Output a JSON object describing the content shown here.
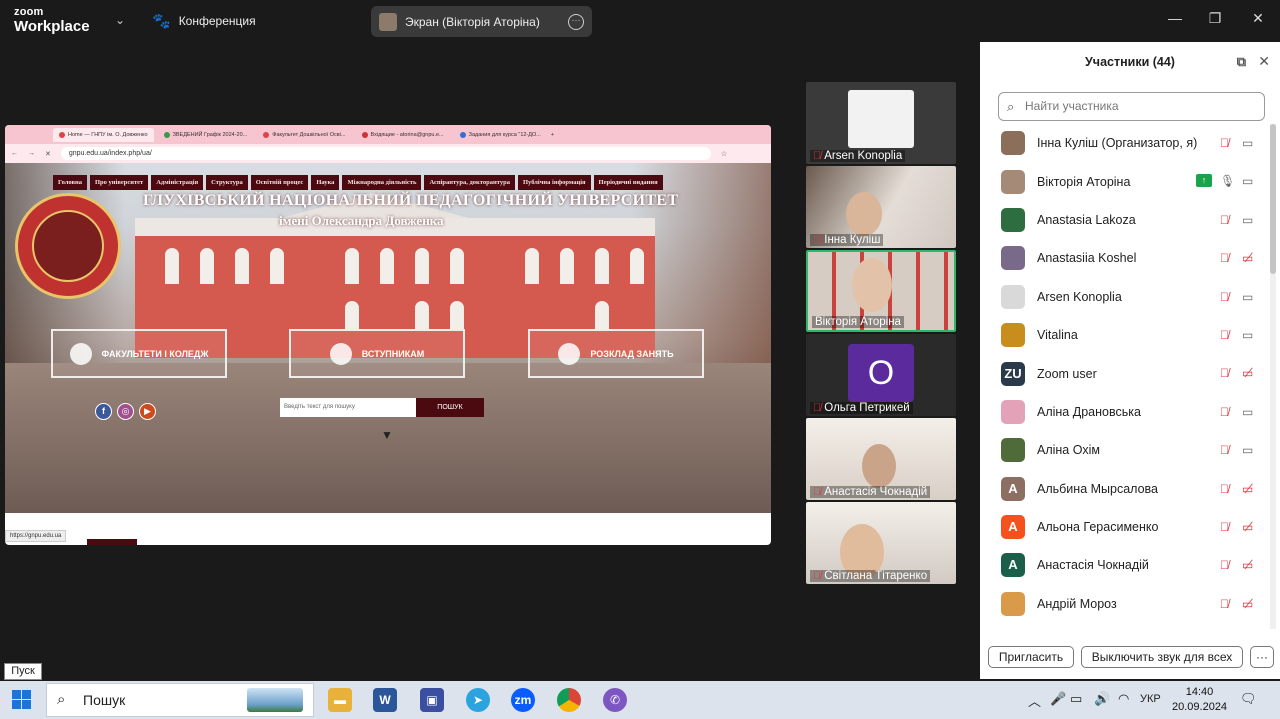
{
  "zoom": {
    "logo_top": "zoom",
    "logo_bottom": "Workplace",
    "meeting_label": "Конференция",
    "share_label": "Экран (Вікторія Аторіна)",
    "win_min": "—",
    "win_restore": "❐",
    "win_close": "✕"
  },
  "browser": {
    "tabs": [
      "Home — ГНПУ ім. О. Довженко",
      "ЗВЕДЕНИЙ Графік 2024-20...",
      "Факультет Дошкільної Осві...",
      "Вхідящие - atorina@gnpu.e...",
      "Задания для курса \"12-ДО..."
    ],
    "url": "gnpu.edu.ua/index.php/ua/",
    "status_url": "https://gnpu.edu.ua"
  },
  "site": {
    "nav": [
      "Головна",
      "Про університет",
      "Адміністрація",
      "Структура",
      "Освітній процес",
      "Наука",
      "Міжнародна діяльність",
      "Аспірантура, докторантура",
      "Публічна інформація",
      "Періодичні видання"
    ],
    "title": "ГЛУХІВСЬКИЙ НАЦІОНАЛЬНИЙ ПЕДАГОГІЧНИЙ УНІВЕРСИТЕТ",
    "subtitle": "імені Олександра Довженка",
    "cta": [
      "ФАКУЛЬТЕТИ І КОЛЕДЖ",
      "ВСТУПНИКАМ",
      "РОЗКЛАД ЗАНЯТЬ"
    ],
    "search_placeholder": "Введіть текст для пошуку",
    "search_button": "ПОШУК"
  },
  "tiles": [
    "Arsen Konoplia",
    "Інна Куліш",
    "Вікторія Аторіна",
    "Ольга Петрикей",
    "Анастасія Чокнадій",
    "Світлана Тітаренко"
  ],
  "tile_avatar_letter": "O",
  "panel": {
    "title": "Участники (44)",
    "search_placeholder": "Найти участника",
    "invite": "Пригласить",
    "mute_all": "Выключить звук для всех",
    "more": "···",
    "participants": [
      {
        "name": "Інна Куліш (Организатор, я)",
        "avatar": "",
        "color": "#8b6f5a"
      },
      {
        "name": "Вікторія Аторіна",
        "avatar": "",
        "color": "#a58a78"
      },
      {
        "name": "Anastasia Lakoza",
        "avatar": "",
        "color": "#2d6d3f"
      },
      {
        "name": "Anastasiia Koshel",
        "avatar": "",
        "color": "#7a6a8a"
      },
      {
        "name": "Arsen Konoplia",
        "avatar": "",
        "color": "#d9d9d9"
      },
      {
        "name": "Vitalina",
        "avatar": "",
        "color": "#c98d1e"
      },
      {
        "name": "Zoom user",
        "avatar": "ZU",
        "color": "#2b3a4a"
      },
      {
        "name": "Аліна Драновська",
        "avatar": "",
        "color": "#e3a2b8"
      },
      {
        "name": "Аліна Охім",
        "avatar": "",
        "color": "#4f6b3a"
      },
      {
        "name": "Альбина Мырсалова",
        "avatar": "А",
        "color": "#8d6e63"
      },
      {
        "name": "Альона Герасименко",
        "avatar": "А",
        "color": "#f4511e"
      },
      {
        "name": "Анастасія Чокнадій",
        "avatar": "А",
        "color": "#1b5e4a"
      },
      {
        "name": "Андрій Мороз",
        "avatar": "",
        "color": "#d99a4a"
      }
    ]
  },
  "tooltip": "Пуск",
  "taskbar": {
    "search": "Пошук",
    "lang": "УКР",
    "time": "14:40",
    "date": "20.09.2024"
  }
}
